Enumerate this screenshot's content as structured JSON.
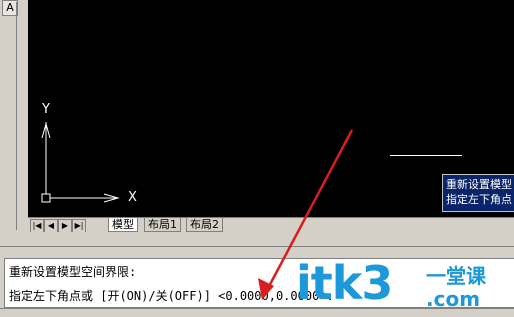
{
  "toolbar": {
    "button_a_label": "A"
  },
  "canvas": {
    "ucs_y_label": "Y",
    "ucs_x_label": "X"
  },
  "tooltip": {
    "line1": "重新设置模型",
    "line2": "指定左下角点"
  },
  "tabs": {
    "nav": [
      "|◀",
      "◀",
      "▶",
      "▶|"
    ],
    "items": [
      "模型",
      "布局1",
      "布局2"
    ],
    "active": "模型"
  },
  "command": {
    "line1": "重新设置模型空间界限:",
    "line2": "指定左下角点或 [开(ON)/关(OFF)] <0.0000,0.0000>:"
  },
  "watermark": {
    "main": "itk3",
    "side_top": "一堂课",
    "side_bottom": ".com"
  },
  "colors": {
    "canvas": "#000000",
    "tooltip_bg": "#0a246a",
    "arrow": "#d81e1e",
    "watermark": "#1d98d8"
  }
}
